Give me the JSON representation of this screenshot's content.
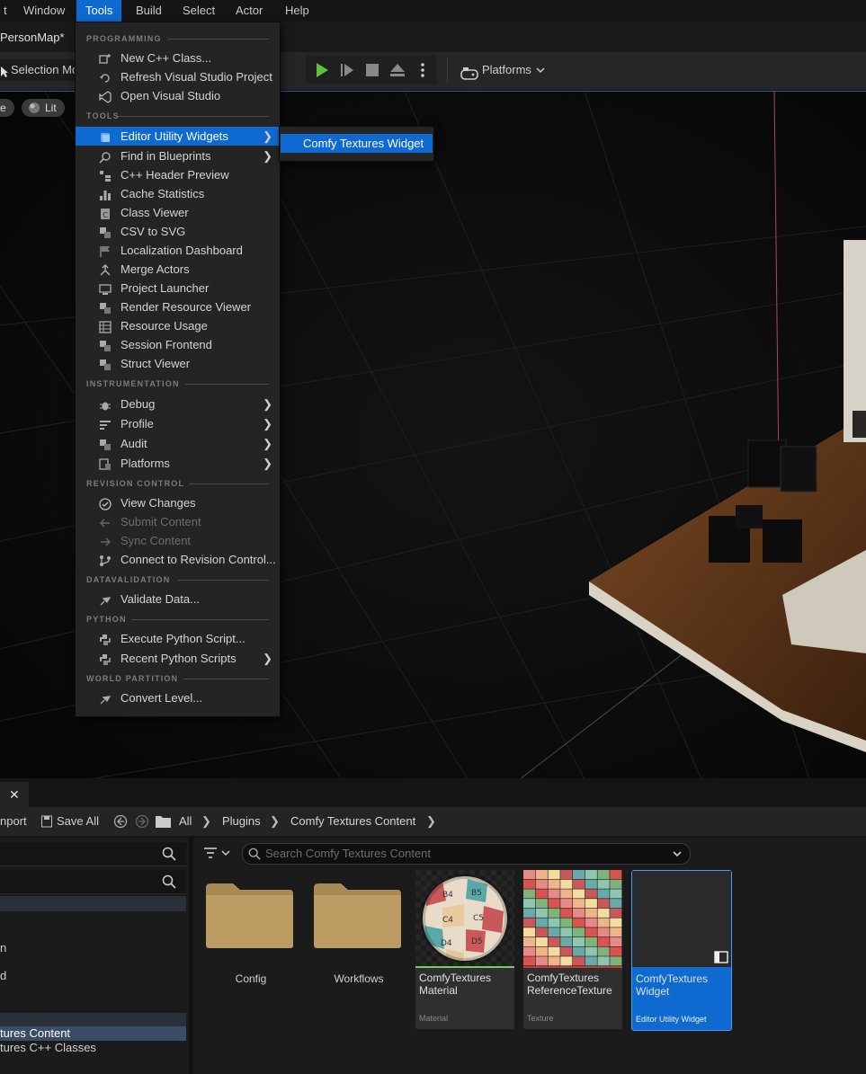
{
  "menubar": {
    "items": [
      {
        "label": "t",
        "x": -4
      },
      {
        "label": "Window"
      },
      {
        "label": "Tools"
      },
      {
        "label": "Build"
      },
      {
        "label": "Select"
      },
      {
        "label": "Actor"
      },
      {
        "label": "Help"
      }
    ],
    "active_index": 2
  },
  "level_tab": "PersonMap*",
  "toolbar": {
    "selection_mode": "Selection Mo",
    "platforms_label": "Platforms"
  },
  "viewport": {
    "view_mode_left": "e",
    "lit_label": "Lit"
  },
  "tools_menu": {
    "sections": [
      {
        "title": "PROGRAMMING"
      },
      {
        "title": "TOOLS"
      },
      {
        "title": "INSTRUMENTATION"
      },
      {
        "title": "REVISION CONTROL"
      },
      {
        "title": "DATAVALIDATION"
      },
      {
        "title": "PYTHON"
      },
      {
        "title": "WORLD PARTITION"
      }
    ],
    "items": [
      {
        "label": "New C++ Class...",
        "icon": "cpp-class-icon"
      },
      {
        "label": "Refresh Visual Studio Project",
        "icon": "refresh-project-icon"
      },
      {
        "label": "Open Visual Studio",
        "icon": "visual-studio-icon"
      },
      {
        "label": "Editor Utility Widgets",
        "icon": "widget-icon",
        "submenu": true,
        "highlighted": true
      },
      {
        "label": "Find in Blueprints",
        "icon": "find-blueprints-icon",
        "submenu": true
      },
      {
        "label": "C++ Header Preview",
        "icon": "header-preview-icon"
      },
      {
        "label": "Cache Statistics",
        "icon": "statistics-icon"
      },
      {
        "label": "Class Viewer",
        "icon": "class-viewer-icon"
      },
      {
        "label": "CSV to SVG",
        "icon": "csv-svg-icon"
      },
      {
        "label": "Localization Dashboard",
        "icon": "flag-icon"
      },
      {
        "label": "Merge Actors",
        "icon": "merge-icon"
      },
      {
        "label": "Project Launcher",
        "icon": "launcher-icon"
      },
      {
        "label": "Render Resource Viewer",
        "icon": "render-resource-icon"
      },
      {
        "label": "Resource Usage",
        "icon": "table-icon"
      },
      {
        "label": "Session Frontend",
        "icon": "session-icon"
      },
      {
        "label": "Struct Viewer",
        "icon": "struct-viewer-icon"
      },
      {
        "label": "Debug",
        "icon": "bug-icon",
        "submenu": true
      },
      {
        "label": "Profile",
        "icon": "profile-icon",
        "submenu": true
      },
      {
        "label": "Audit",
        "icon": "audit-icon",
        "submenu": true
      },
      {
        "label": "Platforms",
        "icon": "platforms-icon",
        "submenu": true
      },
      {
        "label": "View Changes",
        "icon": "check-circle-icon"
      },
      {
        "label": "Submit Content",
        "icon": "arrow-left-icon",
        "disabled": true
      },
      {
        "label": "Sync Content",
        "icon": "arrow-right-icon",
        "disabled": true
      },
      {
        "label": "Connect to Revision Control...",
        "icon": "branch-icon"
      },
      {
        "label": "Validate Data...",
        "icon": "validate-icon"
      },
      {
        "label": "Execute Python Script...",
        "icon": "python-icon"
      },
      {
        "label": "Recent Python Scripts",
        "icon": "python-icon",
        "submenu": true
      },
      {
        "label": "Convert Level...",
        "icon": "convert-icon"
      }
    ]
  },
  "submenu": {
    "item": "Comfy Textures Widget"
  },
  "content_browser": {
    "import_label": "nport",
    "save_all_label": "Save All",
    "breadcrumb": [
      "All",
      "Plugins",
      "Comfy Textures Content"
    ],
    "search_placeholder": "Search Comfy Textures Content",
    "tree": [
      {
        "label": "n"
      },
      {
        "label": "d"
      },
      {
        "label": "tures Content"
      },
      {
        "label": "tures C++ Classes"
      }
    ],
    "folders": [
      {
        "label": "Config"
      },
      {
        "label": "Workflows"
      }
    ],
    "assets": [
      {
        "name_line1": "ComfyTextures",
        "name_line2": "Material",
        "kind": "Material",
        "color": "#6ad15a"
      },
      {
        "name_line1": "ComfyTextures",
        "name_line2": "ReferenceTexture",
        "kind": "Texture",
        "color": "#c43a3a"
      },
      {
        "name_line1": "ComfyTextures",
        "name_line2": "Widget",
        "kind": "Editor Utility Widget",
        "color": "#0e6ad1"
      }
    ]
  },
  "colors": {
    "accent": "#0e6ad1",
    "folder": "#b99a62"
  }
}
